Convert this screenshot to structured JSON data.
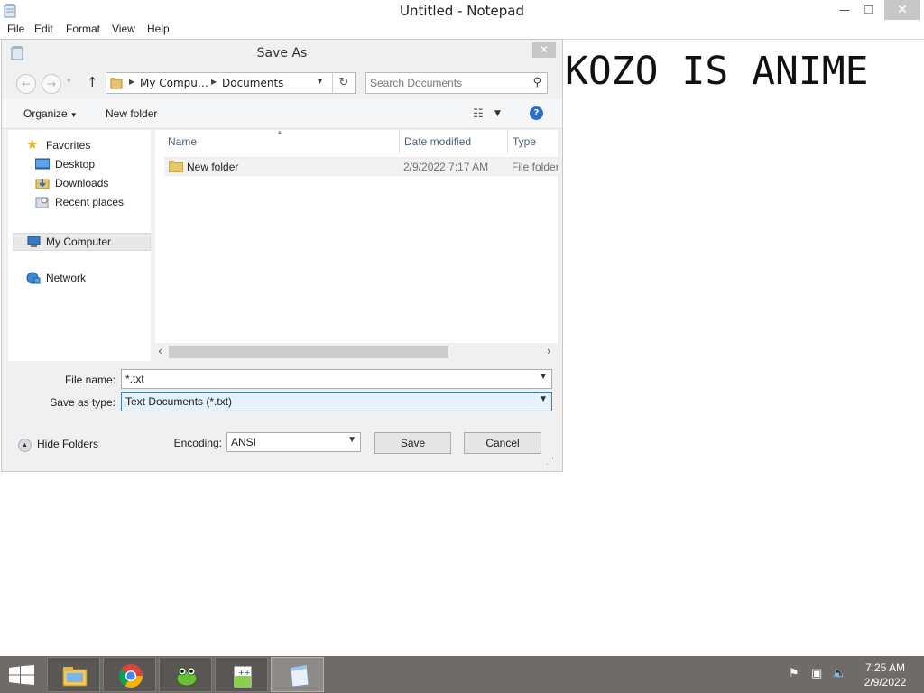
{
  "window": {
    "title": "Untitled - Notepad",
    "min_glyph": "—",
    "max_glyph": "❐",
    "close_glyph": "✕"
  },
  "menu": [
    "File",
    "Edit",
    "Format",
    "View",
    "Help"
  ],
  "editor": {
    "content": "KOZO IS ANIME"
  },
  "dialog": {
    "title": "Save As",
    "close_glyph": "✕",
    "nav": {
      "back_glyph": "←",
      "forward_glyph": "→",
      "up_glyph": "↑",
      "dropdown_glyph": "▾"
    },
    "breadcrumb": [
      "My Compu…",
      "Documents"
    ],
    "breadcrumb_sep": "▶",
    "refresh_glyph": "↻",
    "search": {
      "placeholder": "Search Documents",
      "icon": "search-icon"
    },
    "toolbar": {
      "organize": "Organize",
      "new_folder": "New folder",
      "help_glyph": "?"
    },
    "nav_pane": {
      "favorites": "Favorites",
      "items": [
        "Desktop",
        "Downloads",
        "Recent places"
      ],
      "computer": "My Computer",
      "network": "Network"
    },
    "columns": {
      "name": "Name",
      "date": "Date modified",
      "type": "Type"
    },
    "files": [
      {
        "name": "New folder",
        "date": "2/9/2022 7:17 AM",
        "type": "File folder"
      }
    ],
    "form": {
      "file_name_label": "File name:",
      "file_name_value": "*.txt",
      "type_label": "Save as type:",
      "type_value": "Text Documents (*.txt)",
      "encoding_label": "Encoding:",
      "encoding_value": "ANSI",
      "save": "Save",
      "cancel": "Cancel",
      "hide_folders": "Hide Folders"
    }
  },
  "taskbar": {
    "apps": [
      "file-explorer-icon",
      "chrome-icon",
      "frog-app-icon",
      "notepad-plus-plus-icon",
      "notepad-icon"
    ],
    "time": "7:25 AM",
    "date": "2/9/2022"
  },
  "colors": {
    "taskbar": "#6f6b69",
    "selection": "#e5f1fb",
    "accent": "#2a6fc9"
  }
}
